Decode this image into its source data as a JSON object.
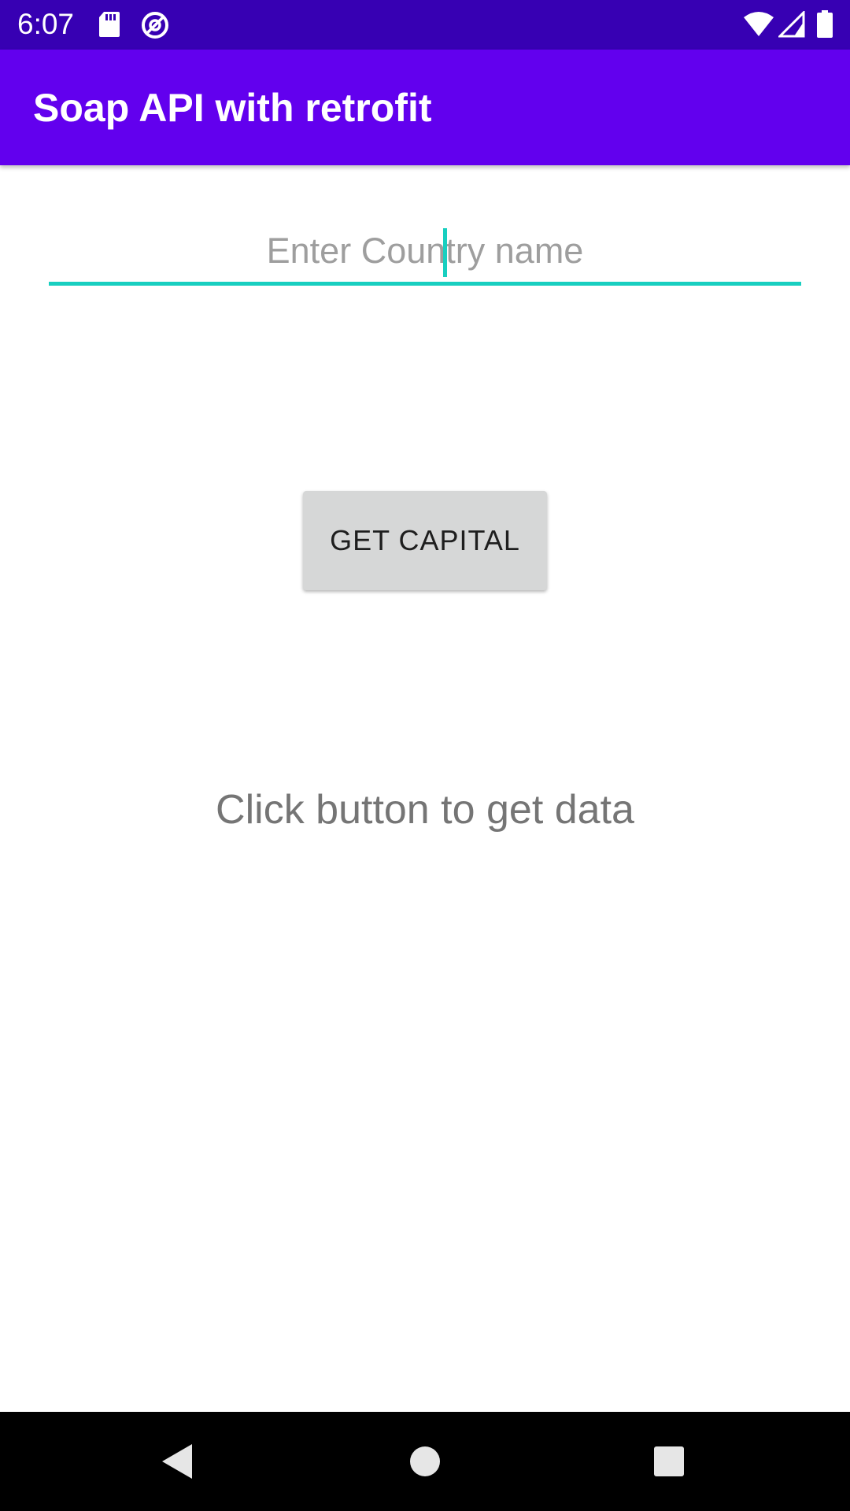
{
  "status_bar": {
    "time": "6:07",
    "icons": [
      "sd-card-icon",
      "sync-icon",
      "wifi-icon",
      "signal-icon",
      "battery-icon"
    ],
    "background": "#3700b3"
  },
  "app_bar": {
    "title": "Soap API with retrofit",
    "background": "#6200ee"
  },
  "form": {
    "country_input": {
      "value": "",
      "placeholder": "Enter Country name"
    },
    "accent_color": "#18cfc0",
    "get_capital_label": "GET CAPITAL"
  },
  "result": {
    "text": "Click button to get data"
  },
  "nav_bar": {
    "buttons": [
      "back-icon",
      "home-icon",
      "recents-icon"
    ]
  }
}
